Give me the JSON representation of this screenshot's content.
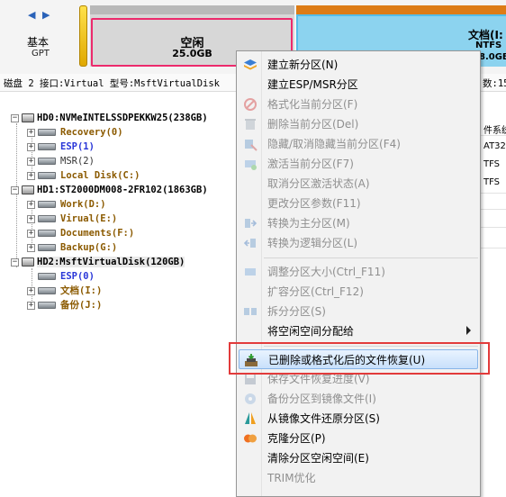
{
  "disk_bar": {
    "nav_arrows": "◀ ▶",
    "disk_type": "基本",
    "disk_style": "GPT",
    "free_partition": {
      "label": "空闲",
      "size": "25.0GB"
    },
    "doc_partition": {
      "label": "文档(I:",
      "fs": "NTFS",
      "size": "8.0GB"
    }
  },
  "info_line": {
    "text": "磁盘 2 接口:Virtual  型号:MsftVirtualDisk",
    "right": "数:15"
  },
  "tree": {
    "disks": [
      {
        "name": "HD0:NVMeINTELSSDPEKKW25(238GB)",
        "partitions": [
          "Recovery(0)",
          "ESP(1)",
          "MSR(2)",
          "Local Disk(C:)"
        ]
      },
      {
        "name": "HD1:ST2000DM008-2FR102(1863GB)",
        "partitions": [
          "Work(D:)",
          "Virual(E:)",
          "Documents(F:)",
          "Backup(G:)"
        ]
      },
      {
        "name": "HD2:MsftVirtualDisk(120GB)",
        "partitions": [
          "ESP(0)",
          "文档(I:)",
          "备份(J:)"
        ]
      }
    ]
  },
  "right_table": {
    "header": "件系统",
    "rows": [
      "AT32",
      "TFS",
      "TFS"
    ]
  },
  "context_menu": {
    "items": [
      {
        "label": "建立新分区(N)",
        "icon": "new-partition-icon",
        "enabled": true
      },
      {
        "label": "建立ESP/MSR分区",
        "icon": "",
        "enabled": true
      },
      {
        "label": "格式化当前分区(F)",
        "icon": "format-icon",
        "enabled": false
      },
      {
        "label": "删除当前分区(Del)",
        "icon": "delete-icon",
        "enabled": false
      },
      {
        "label": "隐藏/取消隐藏当前分区(F4)",
        "icon": "hide-icon",
        "enabled": false
      },
      {
        "label": "激活当前分区(F7)",
        "icon": "activate-icon",
        "enabled": false
      },
      {
        "label": "取消分区激活状态(A)",
        "icon": "",
        "enabled": false
      },
      {
        "label": "更改分区参数(F11)",
        "icon": "",
        "enabled": false
      },
      {
        "label": "转换为主分区(M)",
        "icon": "convert-primary-icon",
        "enabled": false
      },
      {
        "label": "转换为逻辑分区(L)",
        "icon": "convert-logical-icon",
        "enabled": false
      },
      {
        "label": "调整分区大小(Ctrl_F11)",
        "icon": "resize-icon",
        "enabled": false
      },
      {
        "label": "扩容分区(Ctrl_F12)",
        "icon": "",
        "enabled": false
      },
      {
        "label": "拆分分区(S)",
        "icon": "split-icon",
        "enabled": false
      },
      {
        "label": "将空闲空间分配给",
        "icon": "",
        "enabled": true,
        "submenu": true
      },
      {
        "label": "已删除或格式化后的文件恢复(U)",
        "icon": "file-recovery-icon",
        "enabled": true,
        "highlighted": true
      },
      {
        "label": "保存文件恢复进度(V)",
        "icon": "save-progress-icon",
        "enabled": false
      },
      {
        "label": "备份分区到镜像文件(I)",
        "icon": "backup-image-icon",
        "enabled": false
      },
      {
        "label": "从镜像文件还原分区(S)",
        "icon": "restore-image-icon",
        "enabled": true
      },
      {
        "label": "克隆分区(P)",
        "icon": "clone-icon",
        "enabled": true
      },
      {
        "label": "清除分区空闲空间(E)",
        "icon": "",
        "enabled": true
      },
      {
        "label": "TRIM优化",
        "icon": "",
        "enabled": false
      }
    ]
  },
  "colors": {
    "selection_outline": "#ec2a6c",
    "highlight_outline": "#e23b3b",
    "partition_blue": "#54bde9",
    "partition_orange": "#dd7c16"
  }
}
